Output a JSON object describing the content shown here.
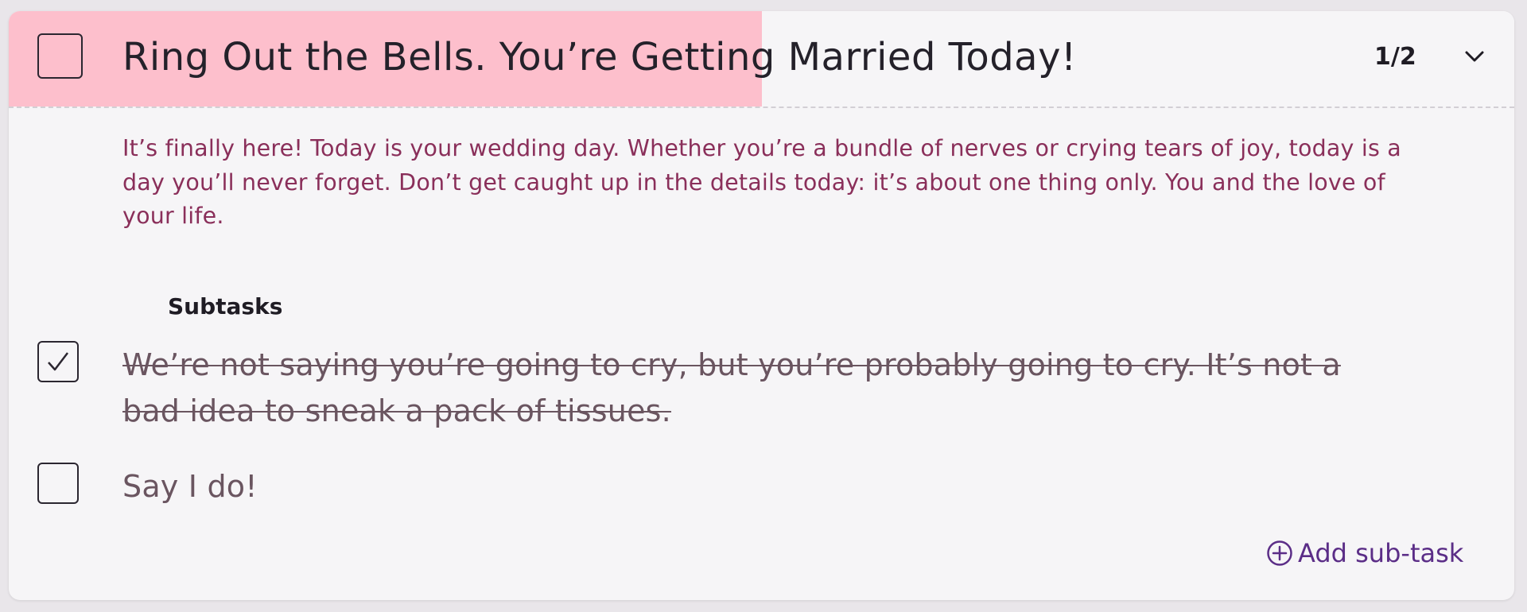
{
  "task": {
    "title": "Ring Out the Bells. You’re Getting Married Today!",
    "counter": "1/2",
    "progress_fraction": 0.5,
    "description": "It’s finally here! Today is your wedding day. Whether you’re a bundle of nerves or crying tears of joy, today is a day you’ll never forget. Don’t get caught up in the details today: it’s about one thing only. You and the love of your life."
  },
  "subtasks": {
    "heading": "Subtasks",
    "items": [
      {
        "text": "We’re not saying you’re going to cry, but you’re probably going to cry. It’s not a bad idea to sneak a pack of tissues.",
        "done": true
      },
      {
        "text": "Say I do!",
        "done": false
      }
    ],
    "add_label": "Add sub-task"
  },
  "icons": {
    "expand": "chevron-down-icon",
    "add": "plus-circle-icon",
    "check": "checkmark-icon"
  },
  "colors": {
    "progress": "#fdbfcc",
    "description": "#8a2f5a",
    "accent": "#5b2d87",
    "card_bg": "#f6f5f7"
  }
}
